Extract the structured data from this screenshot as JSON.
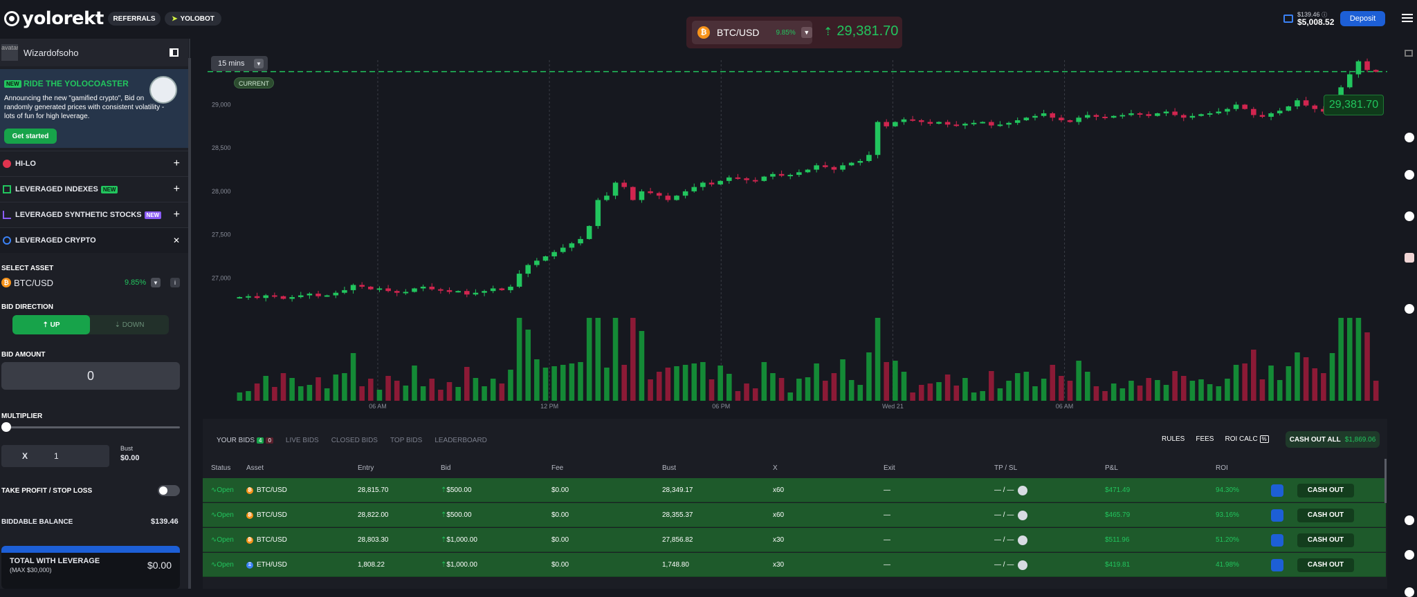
{
  "brand": {
    "name": "yolorekt"
  },
  "nav": {
    "referrals": "REFERRALS",
    "yolobot": "YOLOBOT"
  },
  "ticker": {
    "asset": "BTC/USD",
    "change": "9.85%",
    "price": "29,381.70"
  },
  "wallet": {
    "balance": "$139.46",
    "total": "$5,008.52",
    "deposit": "Deposit"
  },
  "user": {
    "name": "Wizardofsoho",
    "avatar_alt": "avatar"
  },
  "promo": {
    "tag": "NEW",
    "title": "RIDE THE YOLOCOASTER",
    "text": "Announcing the new \"gamified crypto\", Bid on randomly generated prices with consistent volatility - lots of fun for high leverage.",
    "button": "Get started"
  },
  "menu": [
    {
      "label": "HI-LO",
      "action": "+"
    },
    {
      "label": "LEVERAGED INDEXES",
      "tag": "NEW",
      "action": "+"
    },
    {
      "label": "LEVERAGED SYNTHETIC STOCKS",
      "tag": "NEW",
      "action": "+"
    },
    {
      "label": "LEVERAGED CRYPTO",
      "action": "✕"
    }
  ],
  "form": {
    "select_asset_label": "SELECT ASSET",
    "asset": "BTC/USD",
    "asset_change": "9.85%",
    "direction_label": "BID DIRECTION",
    "up": "UP",
    "down": "DOWN",
    "amount_label": "BID AMOUNT",
    "amount": "0",
    "multiplier_label": "MULTIPLIER",
    "mult_x": "X",
    "mult_value": "1",
    "bust_label": "Bust",
    "bust_value": "$0.00",
    "tpsl_label": "TAKE PROFIT / STOP LOSS",
    "biddable_label": "BIDDABLE BALANCE",
    "biddable_value": "$139.46",
    "total_label": "TOTAL WITH LEVERAGE",
    "total_sub": "(MAX $30,000)",
    "total_value": "$0.00"
  },
  "chart": {
    "interval": "15 mins",
    "current_label": "CURRENT",
    "current_value": "29,381.70",
    "y_ticks": [
      "29,000",
      "28,500",
      "28,000",
      "27,500",
      "27,000"
    ],
    "x_ticks": [
      "06 AM",
      "12 PM",
      "06 PM",
      "Wed 21",
      "06 AM"
    ]
  },
  "chart_data": {
    "type": "candlestick",
    "x": [
      "06 AM",
      "12 PM",
      "06 PM",
      "Wed 21",
      "06 AM"
    ],
    "ylim": [
      26700,
      29450
    ],
    "current": 29381.7,
    "closes": [
      26780,
      26790,
      26770,
      26800,
      26790,
      26760,
      26780,
      26800,
      26820,
      26790,
      26800,
      26830,
      26860,
      26920,
      26900,
      26870,
      26880,
      26850,
      26830,
      26840,
      26880,
      26900,
      26870,
      26860,
      26840,
      26850,
      26810,
      26830,
      26850,
      26880,
      26860,
      26900,
      27050,
      27150,
      27200,
      27250,
      27300,
      27350,
      27400,
      27450,
      27600,
      27900,
      27950,
      28100,
      28050,
      27900,
      28000,
      27980,
      27950,
      27900,
      27950,
      28000,
      28050,
      28100,
      28080,
      28120,
      28160,
      28150,
      28130,
      28120,
      28170,
      28200,
      28180,
      28190,
      28220,
      28250,
      28300,
      28280,
      28250,
      28300,
      28330,
      28350,
      28420,
      28800,
      28750,
      28800,
      28830,
      28820,
      28800,
      28780,
      28800,
      28770,
      28760,
      28780,
      28790,
      28800,
      28760,
      28770,
      28790,
      28820,
      28850,
      28870,
      28900,
      28850,
      28820,
      28800,
      28850,
      28880,
      28860,
      28850,
      28870,
      28880,
      28900,
      28890,
      28870,
      28900,
      28920,
      28880,
      28850,
      28870,
      28890,
      28900,
      28920,
      28950,
      29000,
      28950,
      28880,
      28860,
      28900,
      28930,
      28980,
      29050,
      28990,
      28950,
      28920,
      28980,
      29200,
      29350,
      29500,
      29400,
      29380
    ]
  },
  "bottom": {
    "tabs": [
      "YOUR BIDS",
      "LIVE BIDS",
      "CLOSED BIDS",
      "TOP BIDS",
      "LEADERBOARD"
    ],
    "your_bids_open": "4",
    "your_bids_closed": "0",
    "links": [
      "RULES",
      "FEES",
      "ROI CALC"
    ],
    "cash_out_all": "CASH OUT ALL",
    "cash_out_all_value": "$1,869.06",
    "columns": [
      "Status",
      "Asset",
      "Entry",
      "Bid",
      "Fee",
      "Bust",
      "X",
      "Exit",
      "TP / SL",
      "P&L",
      "ROI"
    ],
    "rows": [
      {
        "status": "Open",
        "asset": "BTC/USD",
        "entry": "28,815.70",
        "bid": "$500.00",
        "fee": "$0.00",
        "bust": "28,349.17",
        "x": "x60",
        "exit": "—",
        "tpsl": "— / —",
        "pnl": "$471.49",
        "roi": "94.30%",
        "action": "CASH OUT"
      },
      {
        "status": "Open",
        "asset": "BTC/USD",
        "entry": "28,822.00",
        "bid": "$500.00",
        "fee": "$0.00",
        "bust": "28,355.37",
        "x": "x60",
        "exit": "—",
        "tpsl": "— / —",
        "pnl": "$465.79",
        "roi": "93.16%",
        "action": "CASH OUT"
      },
      {
        "status": "Open",
        "asset": "BTC/USD",
        "entry": "28,803.30",
        "bid": "$1,000.00",
        "fee": "$0.00",
        "bust": "27,856.82",
        "x": "x30",
        "exit": "—",
        "tpsl": "— / —",
        "pnl": "$511.96",
        "roi": "51.20%",
        "action": "CASH OUT"
      },
      {
        "status": "Open",
        "asset": "ETH/USD",
        "entry": "1,808.22",
        "bid": "$1,000.00",
        "fee": "$0.00",
        "bust": "1,748.80",
        "x": "x30",
        "exit": "—",
        "tpsl": "— / —",
        "pnl": "$419.81",
        "roi": "41.98%",
        "action": "CASH OUT"
      }
    ]
  },
  "colors": {
    "accent": "#22c55e",
    "down": "#d1254f",
    "brand_blue": "#1d5fd6"
  }
}
